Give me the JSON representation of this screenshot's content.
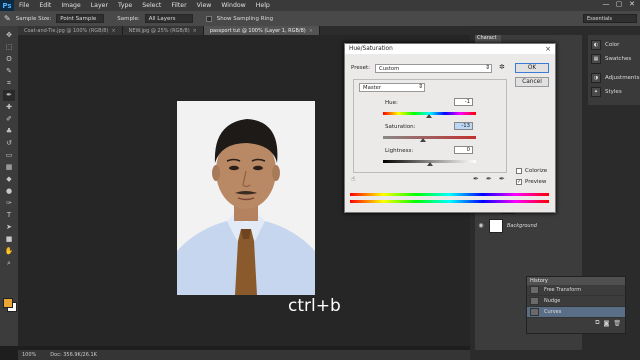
{
  "app": {
    "logo": "Ps",
    "menu": [
      "File",
      "Edit",
      "Image",
      "Layer",
      "Type",
      "Select",
      "Filter",
      "View",
      "Window",
      "Help"
    ],
    "window_controls": [
      "—",
      "▢",
      "✕"
    ]
  },
  "options_bar": {
    "sample_size_label": "Sample Size:",
    "sample_size_value": "Point Sample",
    "sample_label": "Sample:",
    "sample_value": "All Layers",
    "show_ring_label": "Show Sampling Ring",
    "workspace": "Essentials"
  },
  "doc_tabs": [
    {
      "label": "Coat-and-Tie.jpg @ 100% (RGB/8)",
      "active": false
    },
    {
      "label": "NEW.jpg @ 25% (RGB/8)",
      "active": false
    },
    {
      "label": "passport tut @ 100% (Layer 1, RGB/8)",
      "active": true
    }
  ],
  "canvas": {
    "caption": "ctrl+b"
  },
  "status": {
    "zoom": "100%",
    "doc": "Doc: 356.9K/26.1K"
  },
  "right_panel": {
    "char_tab": "Charact",
    "dock": [
      {
        "label": "Color",
        "icon": "color-icon"
      },
      {
        "label": "Swatches",
        "icon": "swatches-icon"
      },
      {
        "label": "Adjustments",
        "icon": "adjustments-icon"
      },
      {
        "label": "Styles",
        "icon": "styles-icon"
      }
    ],
    "layers": [
      {
        "name": "Background"
      }
    ]
  },
  "history": {
    "title": "History",
    "items": [
      {
        "label": "Free Transform",
        "current": false
      },
      {
        "label": "Nudge",
        "current": false
      },
      {
        "label": "Curves",
        "current": true
      }
    ]
  },
  "dialog": {
    "title": "Hue/Saturation",
    "preset_label": "Preset:",
    "preset_value": "Custom",
    "channel": "Master",
    "hue_label": "Hue:",
    "hue_value": "-1",
    "saturation_label": "Saturation:",
    "saturation_value": "-13",
    "lightness_label": "Lightness:",
    "lightness_value": "0",
    "ok_label": "OK",
    "cancel_label": "Cancel",
    "colorize_label": "Colorize",
    "colorize_checked": false,
    "preview_label": "Preview",
    "preview_checked": true,
    "hue_level": -1,
    "saturation_level": -13,
    "lightness_level": 0
  }
}
